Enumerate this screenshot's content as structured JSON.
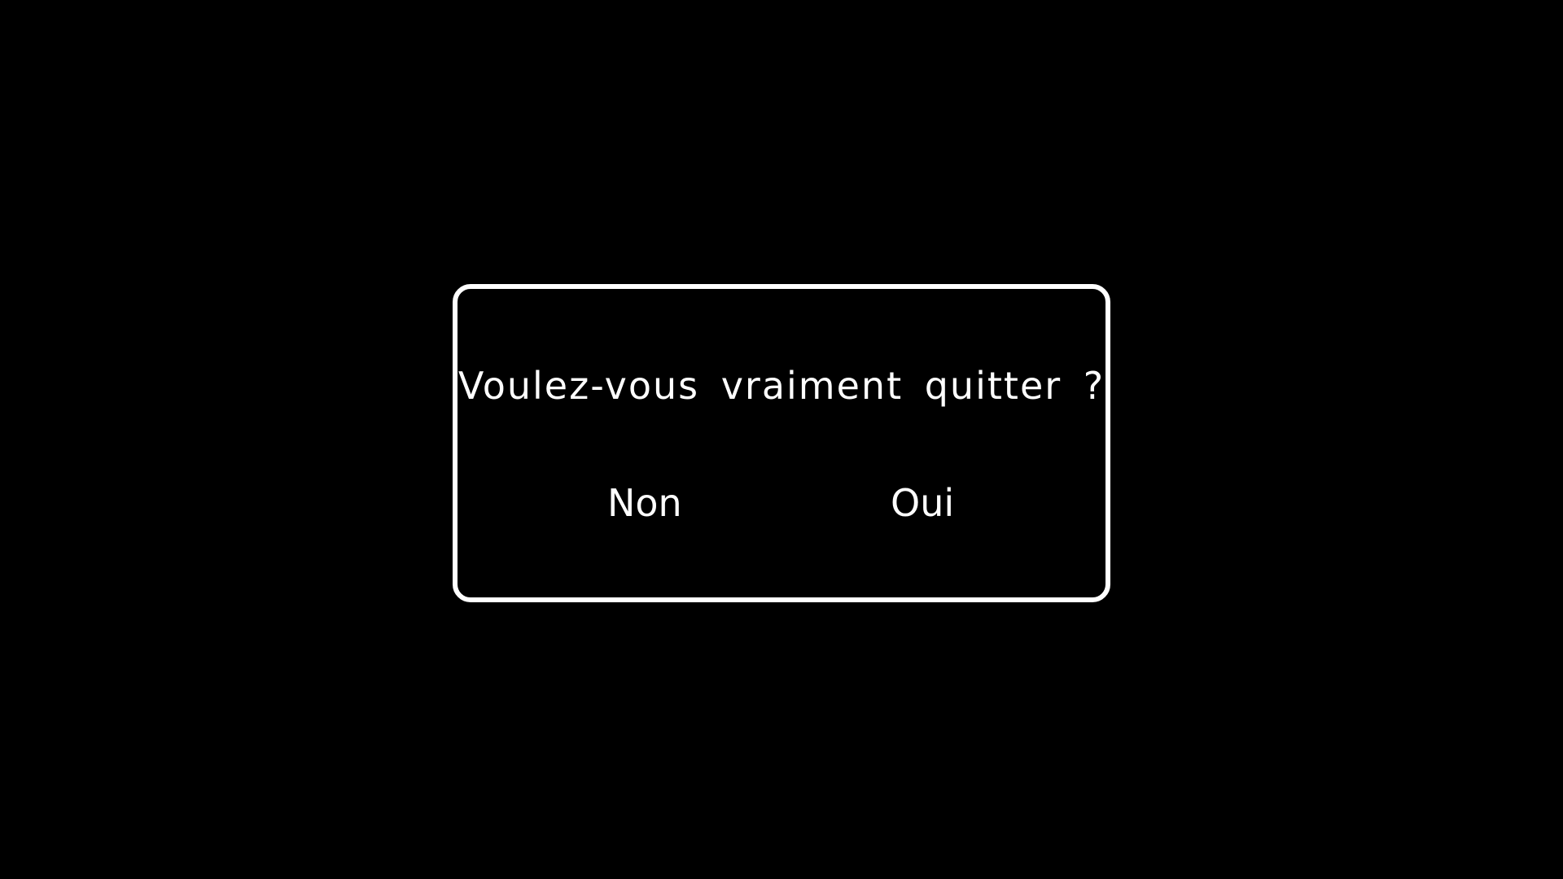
{
  "dialog": {
    "question": "Voulez-vous vraiment quitter ?",
    "no_label": "Non",
    "yes_label": "Oui"
  },
  "colors": {
    "background": "#000000",
    "foreground": "#ffffff"
  }
}
